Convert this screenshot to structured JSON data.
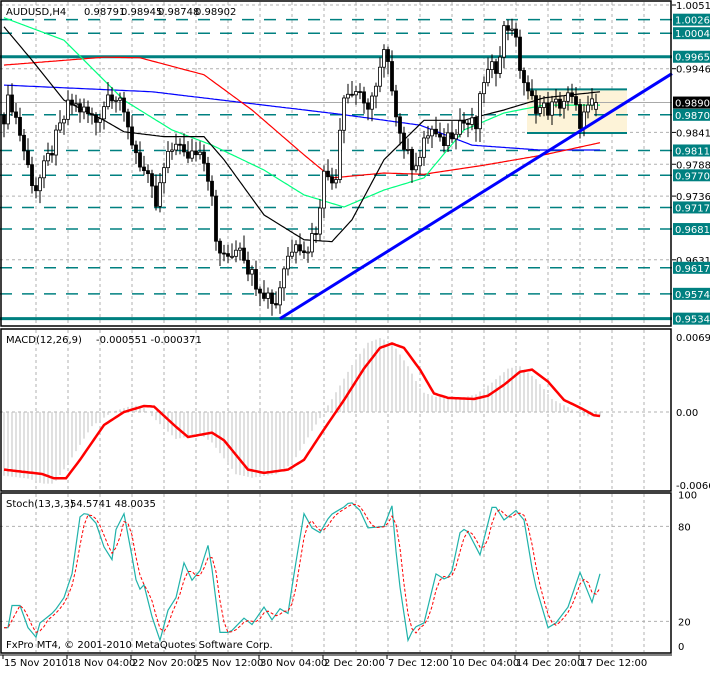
{
  "header": {
    "symbol_timeframe": "AUDUSD,H4",
    "open": "0.98791",
    "high": "0.98945",
    "low": "0.98748",
    "close": "0.98902"
  },
  "copyright": "FxPro MT4, © 2001-2010 MetaQuotes Software Corp.",
  "colors": {
    "teal": "#008080",
    "trend": "#0000ff",
    "bull": "#ffffff",
    "bear": "#000000",
    "ma_blue": "#0000ff",
    "ma_red": "#ff0000",
    "ma_green": "#00ff7f",
    "ma_black": "#000000",
    "macd_signal": "#ff0000",
    "macd_hist": "#c0c0c0",
    "stoch_main": "#20b2aa",
    "stoch_signal": "#ff0000",
    "zone": "#fdf3d8"
  },
  "chart_data": [
    {
      "type": "candlestick",
      "title": "AUDUSD,H4",
      "ylim": [
        0.952,
        1.006
      ],
      "price_axis_labels": [
        "1.00510",
        "0.99460",
        "0.98410",
        "0.97885",
        "0.97360",
        "0.96310"
      ],
      "level_lines": [
        {
          "price": "1.00268",
          "style": "dashed"
        },
        {
          "price": "1.00045",
          "style": "dashed"
        },
        {
          "price": "0.99657",
          "style": "solid"
        },
        {
          "price": "0.98700",
          "style": "dashed"
        },
        {
          "price": "0.98112",
          "style": "dashed"
        },
        {
          "price": "0.97703",
          "style": "dashed"
        },
        {
          "price": "0.97173",
          "style": "dashed"
        },
        {
          "price": "0.96817",
          "style": "dashed"
        },
        {
          "price": "0.96178",
          "style": "dashed"
        },
        {
          "price": "0.95749",
          "style": "dashed"
        },
        {
          "price": "0.95340",
          "style": "solid"
        }
      ],
      "current_price": "0.98902",
      "bars": 149,
      "close_keypoints": [
        [
          0,
          0.987
        ],
        [
          1.5,
          0.99
        ],
        [
          4,
          0.984
        ],
        [
          6.5,
          0.977
        ],
        [
          8,
          0.975
        ],
        [
          10,
          0.978
        ],
        [
          13,
          0.983
        ],
        [
          16.5,
          0.989
        ],
        [
          19,
          0.988
        ],
        [
          23,
          0.986
        ],
        [
          26.5,
          0.991
        ],
        [
          29,
          0.99
        ],
        [
          30,
          0.986
        ],
        [
          33,
          0.981
        ],
        [
          36.5,
          0.975
        ],
        [
          38,
          0.972
        ],
        [
          40,
          0.978
        ],
        [
          43,
          0.983
        ],
        [
          45,
          0.98
        ],
        [
          49,
          0.982
        ],
        [
          51.5,
          0.976
        ],
        [
          53,
          0.966
        ],
        [
          55,
          0.963
        ],
        [
          59,
          0.966
        ],
        [
          61.5,
          0.961
        ],
        [
          65,
          0.958
        ],
        [
          68,
          0.956
        ],
        [
          70,
          0.962
        ],
        [
          73,
          0.967
        ],
        [
          75,
          0.964
        ],
        [
          78.5,
          0.969
        ],
        [
          79.5,
          0.977
        ],
        [
          83,
          0.977
        ],
        [
          84.5,
          0.99
        ],
        [
          88,
          0.991
        ],
        [
          90,
          0.988
        ],
        [
          93,
          0.991
        ],
        [
          95,
          0.997
        ],
        [
          97,
          0.992
        ],
        [
          99,
          0.984
        ],
        [
          101.5,
          0.979
        ],
        [
          104,
          0.98
        ],
        [
          106.5,
          0.985
        ],
        [
          109,
          0.982
        ],
        [
          111.5,
          0.984
        ],
        [
          114,
          0.986
        ],
        [
          118,
          0.985
        ],
        [
          120,
          0.993
        ],
        [
          123,
          0.995
        ],
        [
          125,
          1.001
        ],
        [
          127,
          1.002
        ],
        [
          129,
          0.995
        ],
        [
          131,
          0.99
        ],
        [
          134,
          0.988
        ],
        [
          136.5,
          0.988
        ],
        [
          139,
          0.989
        ],
        [
          141.5,
          0.99
        ],
        [
          144,
          0.986
        ],
        [
          146.5,
          0.988
        ],
        [
          148,
          0.98902
        ]
      ],
      "moving_averages": [
        {
          "color": "ma_blue",
          "points": [
            [
              0,
              0.9919
            ],
            [
              37,
              0.9908
            ],
            [
              84,
              0.9871
            ],
            [
              104,
              0.9853
            ],
            [
              117,
              0.982
            ],
            [
              134,
              0.9812
            ],
            [
              149,
              0.9812
            ]
          ]
        },
        {
          "color": "ma_red",
          "points": [
            [
              0,
              0.9952
            ],
            [
              25,
              0.9965
            ],
            [
              34,
              0.9964
            ],
            [
              50,
              0.9936
            ],
            [
              62,
              0.9878
            ],
            [
              75,
              0.9804
            ],
            [
              82,
              0.9766
            ],
            [
              95,
              0.9774
            ],
            [
              105,
              0.9772
            ],
            [
              120,
              0.9787
            ],
            [
              135,
              0.9804
            ],
            [
              149,
              0.9824
            ]
          ]
        },
        {
          "color": "ma_green",
          "points": [
            [
              0,
              1.003
            ],
            [
              15,
              0.9993
            ],
            [
              30,
              0.9894
            ],
            [
              42,
              0.9845
            ],
            [
              52,
              0.982
            ],
            [
              65,
              0.9779
            ],
            [
              75,
              0.9738
            ],
            [
              85,
              0.9718
            ],
            [
              95,
              0.9746
            ],
            [
              105,
              0.9766
            ],
            [
              115,
              0.9845
            ],
            [
              125,
              0.9873
            ],
            [
              135,
              0.9886
            ],
            [
              149,
              0.9886
            ]
          ]
        },
        {
          "color": "ma_black",
          "points": [
            [
              0,
              1.0015
            ],
            [
              7,
              0.996
            ],
            [
              15,
              0.9894
            ],
            [
              25,
              0.9861
            ],
            [
              30,
              0.9842
            ],
            [
              40,
              0.9834
            ],
            [
              50,
              0.9834
            ],
            [
              55,
              0.9796
            ],
            [
              65,
              0.9705
            ],
            [
              75,
              0.9664
            ],
            [
              82,
              0.9661
            ],
            [
              87,
              0.9697
            ],
            [
              95,
              0.9796
            ],
            [
              105,
              0.9861
            ],
            [
              115,
              0.9861
            ],
            [
              125,
              0.9878
            ],
            [
              135,
              0.9898
            ],
            [
              149,
              0.9908
            ]
          ]
        }
      ],
      "trendline": {
        "from": [
          69,
          0.9534
        ],
        "to": [
          167,
          0.9938
        ]
      },
      "consolidation_zone": {
        "bar_start": 131,
        "bar_end": 156,
        "top": 0.9912,
        "bottom": 0.984
      }
    },
    {
      "type": "line",
      "title": "MACD(12,26,9) -0.000551 -0.000371",
      "label": "MACD(12,26,9)",
      "values_text": "-0.000551 -0.000371",
      "axis_labels": [
        "0.00690",
        "0.00",
        "-0.00663"
      ],
      "ylim": [
        -0.00663,
        0.0069
      ],
      "signal_keypoints": [
        [
          0,
          -0.0053
        ],
        [
          9.5,
          -0.0057
        ],
        [
          12.5,
          -0.0061
        ],
        [
          15.5,
          -0.0061
        ],
        [
          19,
          -0.0044
        ],
        [
          25,
          -0.0012
        ],
        [
          30,
          0
        ],
        [
          35,
          0.00055
        ],
        [
          37.5,
          0.0005
        ],
        [
          42.5,
          -0.0012
        ],
        [
          46,
          -0.0023
        ],
        [
          52,
          -0.0019
        ],
        [
          55,
          -0.0026
        ],
        [
          61,
          -0.0053
        ],
        [
          65,
          -0.0056
        ],
        [
          71,
          -0.0053
        ],
        [
          75,
          -0.0044
        ],
        [
          80,
          -0.0016
        ],
        [
          85,
          0.0011
        ],
        [
          90,
          0.004
        ],
        [
          94,
          0.0059
        ],
        [
          97,
          0.0063
        ],
        [
          100,
          0.0059
        ],
        [
          104,
          0.0039
        ],
        [
          107.5,
          0.0017
        ],
        [
          111,
          0.0013
        ],
        [
          117.5,
          0.0012
        ],
        [
          121,
          0.0015
        ],
        [
          125,
          0.0025
        ],
        [
          129,
          0.0037
        ],
        [
          132,
          0.0039
        ],
        [
          136,
          0.0028
        ],
        [
          140,
          0.0011
        ],
        [
          144,
          0.0004
        ],
        [
          147.5,
          -0.0003
        ],
        [
          149,
          -0.00037
        ]
      ],
      "histogram_lead_bars": 3
    },
    {
      "type": "line",
      "title": "Stoch(13,3,3) 54.5741 48.0035",
      "label": "Stoch(13,3,3)",
      "values_text": "54.5741 48.0035",
      "axis_labels": [
        "100",
        "80",
        "20",
        "0"
      ],
      "ylim": [
        0,
        100
      ],
      "levels": [
        80,
        20
      ],
      "main_keypoints": [
        [
          1,
          16
        ],
        [
          2,
          30
        ],
        [
          4,
          30
        ],
        [
          6,
          16
        ],
        [
          8,
          10
        ],
        [
          9,
          19
        ],
        [
          12.5,
          26
        ],
        [
          15,
          35
        ],
        [
          17,
          50
        ],
        [
          19,
          86
        ],
        [
          20.5,
          89
        ],
        [
          23,
          82
        ],
        [
          25,
          67
        ],
        [
          27,
          59
        ],
        [
          28,
          78
        ],
        [
          30,
          88
        ],
        [
          32,
          61
        ],
        [
          33.5,
          39
        ],
        [
          35,
          43
        ],
        [
          37,
          23
        ],
        [
          39,
          8
        ],
        [
          41,
          27
        ],
        [
          43,
          35
        ],
        [
          45,
          57
        ],
        [
          47,
          46
        ],
        [
          49,
          52
        ],
        [
          51,
          68
        ],
        [
          52,
          53
        ],
        [
          54,
          13
        ],
        [
          56.5,
          13
        ],
        [
          60,
          22
        ],
        [
          62,
          18
        ],
        [
          65,
          29
        ],
        [
          67,
          21
        ],
        [
          69,
          28
        ],
        [
          71,
          25
        ],
        [
          72.5,
          50
        ],
        [
          75,
          88
        ],
        [
          77,
          79
        ],
        [
          79,
          76
        ],
        [
          81.5,
          87
        ],
        [
          85.5,
          93
        ],
        [
          86.5,
          96
        ],
        [
          89,
          90
        ],
        [
          91,
          79
        ],
        [
          95,
          80
        ],
        [
          97,
          93
        ],
        [
          98.5,
          50
        ],
        [
          101,
          8
        ],
        [
          102.5,
          16
        ],
        [
          105,
          19
        ],
        [
          108,
          50
        ],
        [
          110.5,
          46
        ],
        [
          112,
          52
        ],
        [
          114,
          76
        ],
        [
          115.5,
          79
        ],
        [
          119,
          62
        ],
        [
          122,
          92
        ],
        [
          123,
          92
        ],
        [
          125,
          84
        ],
        [
          128,
          90
        ],
        [
          130,
          84
        ],
        [
          132.5,
          46
        ],
        [
          136,
          16
        ],
        [
          138,
          19
        ],
        [
          141,
          29
        ],
        [
          144,
          51
        ],
        [
          147,
          32
        ],
        [
          149.5,
          54.57
        ]
      ]
    }
  ],
  "time_axis_labels": [
    "15 Nov 2010",
    "18 Nov 04:00",
    "22 Nov 20:00",
    "25 Nov 12:00",
    "30 Nov 04:00",
    "2 Dec 20:00",
    "7 Dec 12:00",
    "10 Dec 04:00",
    "14 Dec 20:00",
    "17 Dec 12:00"
  ]
}
